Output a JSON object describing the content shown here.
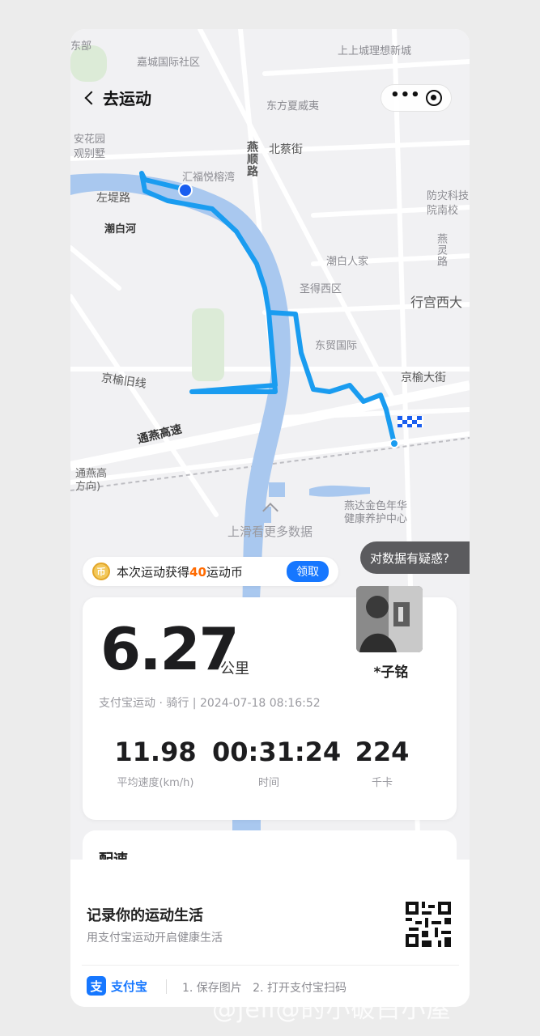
{
  "nav": {
    "back_label": "去运动",
    "menu_icon": "more-dots-icon",
    "close_icon": "target-close-icon"
  },
  "map": {
    "labels": {
      "jiacheng": "嘉城国际社区",
      "shangshangcheng": "上上城理想新城",
      "dongfang": "东方夏威夷",
      "beicai": "北蔡街",
      "anhua": "安花园\n观别墅",
      "huifu": "汇福悦榕湾",
      "zuodi": "左堤路",
      "chaobai_river": "潮白河",
      "fangzai": "防灾科技\n院南校",
      "yanling": "燕灵路",
      "chaobai_people": "潮白人家",
      "shengde": "圣得西区",
      "xinggong": "行宫西大",
      "dongmao": "东贸国际",
      "jingyu_old": "京榆旧线",
      "jingyu_ave": "京榆大街",
      "tongyan": "通燕高速",
      "tongyan_dir": "通燕高\n方向)",
      "yanda": "燕达金色年华\n健康养护中心",
      "yanshun": "燕顺路",
      "top_left": "东部",
      "left_road": "燕顺路"
    },
    "route_color": "#1a9cf0",
    "water_color": "#a9c8ef",
    "swipe_hint": "上滑看更多数据"
  },
  "coin_bar": {
    "prefix": "本次运动获得",
    "coins": "40",
    "suffix": "运动币",
    "claim_label": "领取"
  },
  "doubt_button": "对数据有疑惑?",
  "stats": {
    "distance": "6.27",
    "distance_unit": "公里",
    "user_name": "*子铭",
    "meta": "支付宝运动 · 骑行 | 2024-07-18 08:16:52",
    "avg_speed": "11.98",
    "avg_speed_label": "平均速度(km/h)",
    "duration": "00:31:24",
    "duration_label": "时间",
    "calories": "224",
    "calories_label": "千卡"
  },
  "pace_title": "配速",
  "footer": {
    "title": "记录你的运动生活",
    "subtitle": "用支付宝运动开启健康生活",
    "brand": "支付宝",
    "brand_mark": "支",
    "steps": "1. 保存图片   2. 打开支付宝扫码"
  },
  "watermark": "@jell@的小破白小屋",
  "colors": {
    "accent": "#1677ff",
    "coin_highlight": "#ff6a00"
  }
}
